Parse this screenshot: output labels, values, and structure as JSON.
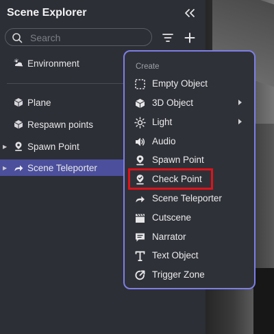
{
  "panel": {
    "title": "Scene Explorer",
    "search_placeholder": "Search"
  },
  "tree": {
    "items": [
      {
        "label": "Environment",
        "icon": "environment-icon",
        "caret": false
      },
      {
        "label": "Plane",
        "icon": "cube-icon",
        "caret": false
      },
      {
        "label": "Respawn points",
        "icon": "cube-icon",
        "caret": false
      },
      {
        "label": "Spawn Point",
        "icon": "spawn-pin-icon",
        "caret": true
      },
      {
        "label": "Scene Teleporter",
        "icon": "teleport-arrow-icon",
        "caret": true,
        "selected": true
      }
    ]
  },
  "menu": {
    "header": "Create",
    "items": [
      {
        "label": "Empty Object",
        "icon": "dashed-square-icon",
        "submenu": false
      },
      {
        "label": "3D Object",
        "icon": "cube-icon",
        "submenu": true
      },
      {
        "label": "Light",
        "icon": "sun-icon",
        "submenu": true
      },
      {
        "label": "Audio",
        "icon": "speaker-icon",
        "submenu": false
      },
      {
        "label": "Spawn Point",
        "icon": "spawn-pin-icon",
        "submenu": false
      },
      {
        "label": "Check Point",
        "icon": "checkpoint-pin-icon",
        "submenu": false,
        "highlighted": true
      },
      {
        "label": "Scene Teleporter",
        "icon": "teleport-arrow-icon",
        "submenu": false
      },
      {
        "label": "Cutscene",
        "icon": "clapperboard-icon",
        "submenu": false
      },
      {
        "label": "Narrator",
        "icon": "speech-bubble-icon",
        "submenu": false
      },
      {
        "label": "Text Object",
        "icon": "text-t-icon",
        "submenu": false
      },
      {
        "label": "Trigger Zone",
        "icon": "trigger-zone-icon",
        "submenu": false
      }
    ]
  },
  "colors": {
    "panel_bg": "#2d2f36",
    "selected_row": "#4b4f9c",
    "menu_border": "#7d7fe8",
    "highlight_box": "#e0121b"
  }
}
